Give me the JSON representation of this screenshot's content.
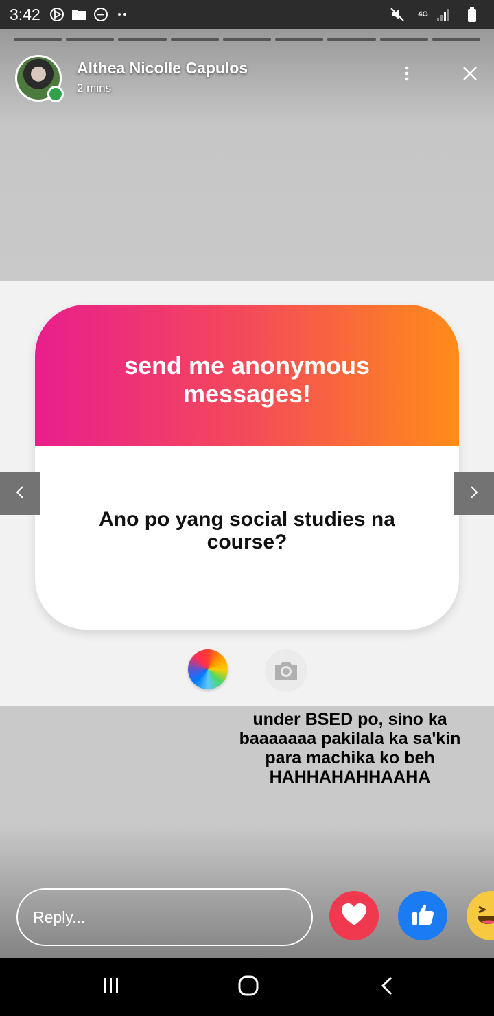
{
  "status_bar": {
    "time": "3:42",
    "network": "4G"
  },
  "story": {
    "progress_segments": 9,
    "user_name": "Althea Nicolle Capulos",
    "time_ago": "2 mins",
    "card_header": "send me anonymous messages!",
    "card_question": "Ano po yang social studies na course?",
    "reply_caption": "under BSED po, sino ka baaaaaaa pakilala ka sa'kin para machika ko beh HAHHAHAHHAAHA"
  },
  "reply_bar": {
    "placeholder": "Reply..."
  },
  "colors": {
    "gradient_start": "#e91e8c",
    "gradient_end": "#ff8c18",
    "heart": "#f0384f",
    "like": "#1a7bf2",
    "haha": "#f7c940",
    "online": "#31a24c"
  },
  "icons": {
    "status_left": [
      "media-icon",
      "folder-icon",
      "do-not-disturb-icon",
      "more-notifications-icon"
    ],
    "status_right": [
      "mute-icon",
      "network-icon",
      "signal-icon",
      "battery-icon"
    ],
    "header": [
      "more-vertical-icon",
      "close-icon"
    ],
    "card": [
      "color-wheel-icon",
      "camera-icon"
    ],
    "reactions": [
      "heart-icon",
      "like-icon",
      "haha-icon"
    ],
    "navigation": [
      "recent-apps-icon",
      "home-icon",
      "back-icon"
    ]
  }
}
